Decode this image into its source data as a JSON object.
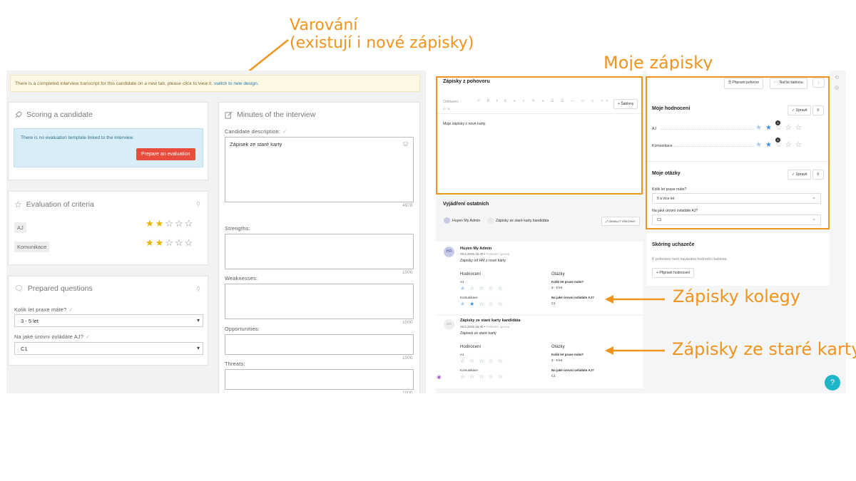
{
  "annotations": {
    "warning_line1": "Varování",
    "warning_line2": "(existují i nové zápisky)",
    "my_notes": "Moje zápisky",
    "colleague_notes": "Zápisky kolegy",
    "old_card_notes": "Zápisky ze staré karty",
    "color": "#f0941e"
  },
  "old_design": {
    "alert": {
      "text": "There is a completed interview transcript for this candidate on a new tab, please click to view it.",
      "link": "switch to new design."
    },
    "scoring": {
      "title": "Scoring a candidate",
      "info": "There is no evaluation template linked to the interview.",
      "button": "Prepare an evaluation"
    },
    "criteria": {
      "title": "Evaluation of criteria",
      "items": [
        {
          "label": "AJ",
          "stars": 2,
          "max": 5
        },
        {
          "label": "Komunikace",
          "stars": 2,
          "max": 5
        }
      ]
    },
    "questions": {
      "title": "Prepared questions",
      "q1_label": "Kolik let praxe máte?",
      "q1_value": "3 - 5 let",
      "q2_label": "Na jaké úrovni ovládáte AJ?",
      "q2_value": "C1"
    },
    "minutes": {
      "title": "Minutes of the interview",
      "desc_label": "Candidate description:",
      "desc_value": "Zápisek ze staré karty",
      "desc_count": "4978",
      "strengths_label": "Strengths:",
      "strengths_count": "1000",
      "weaknesses_label": "Weaknesses:",
      "weaknesses_count": "1000",
      "opportunities_label": "Opportunities:",
      "opportunities_count": "1000",
      "threats_label": "Threats:",
      "threats_count": "1000"
    }
  },
  "new_design": {
    "notes": {
      "title": "Zápisky z pohovoru",
      "format": "Odstavec",
      "templates_btn": "Šablony",
      "content": "Moje zápisky z nové karty."
    },
    "top_buttons": {
      "prepare": "Připravit pohovor",
      "load": "Načíst šablonu"
    },
    "my_ratings": {
      "title": "Moje hodnocení",
      "edit": "Upravit",
      "items": [
        {
          "label": "AJ",
          "stars": 2,
          "badge": "1"
        },
        {
          "label": "Komunikace",
          "stars": 2,
          "badge": "1"
        }
      ]
    },
    "my_questions": {
      "title": "Moje otázky",
      "edit": "Upravit",
      "q1_label": "Kolik let praxe máte?",
      "q1_value": "5 a více let",
      "q2_label": "Na jaké úrovni ovládáte AJ?",
      "q2_value": "C1"
    },
    "others": {
      "title": "Vyjádření ostatních",
      "chip1": "Huyen My Admin",
      "chip2": "Zápisky ze staré karty kandidáta",
      "expand_all": "ODBALIT VŠECHNY"
    },
    "scoring": {
      "title": "Skóring uchazeče",
      "text": "K pohovoru není navázána hodnotící šablona.",
      "button": "Připravit hodnocení"
    },
    "feed": [
      {
        "avatar": "HA",
        "author": "Huyen My Admin",
        "meta": "29.5.2025 16:40",
        "meta2": "Poslední úprava",
        "text": "Zápisky od HM z nové karty",
        "ratings_label": "Hodnocení",
        "r1": "AJ",
        "r1_stars": 1,
        "r2": "Komunikace",
        "r2_stars": 1,
        "q_label": "Otázky",
        "q1": "Kolik let praxe máte?",
        "a1": "3 - 5 let",
        "q2": "Na jaké úrovni ovládáte AJ?",
        "a2": "C1"
      },
      {
        "avatar": "ATS",
        "author": "Zápisky ze staré karty kandidáta",
        "meta": "29.5.2025 16:40",
        "meta2": "Poslední úprava",
        "text": "Zápisek ze staré karty",
        "ratings_label": "Hodnocení",
        "r1": "AJ",
        "r1_stars": 0,
        "r2": "Komunikace",
        "r2_stars": 0,
        "q_label": "Otázky",
        "q1": "Kolik let praxe máte?",
        "a1": "3 - 5 let",
        "q2": "Na jaké úrovni ovládáte AJ?",
        "a2": "C1"
      }
    ],
    "help": "?"
  }
}
